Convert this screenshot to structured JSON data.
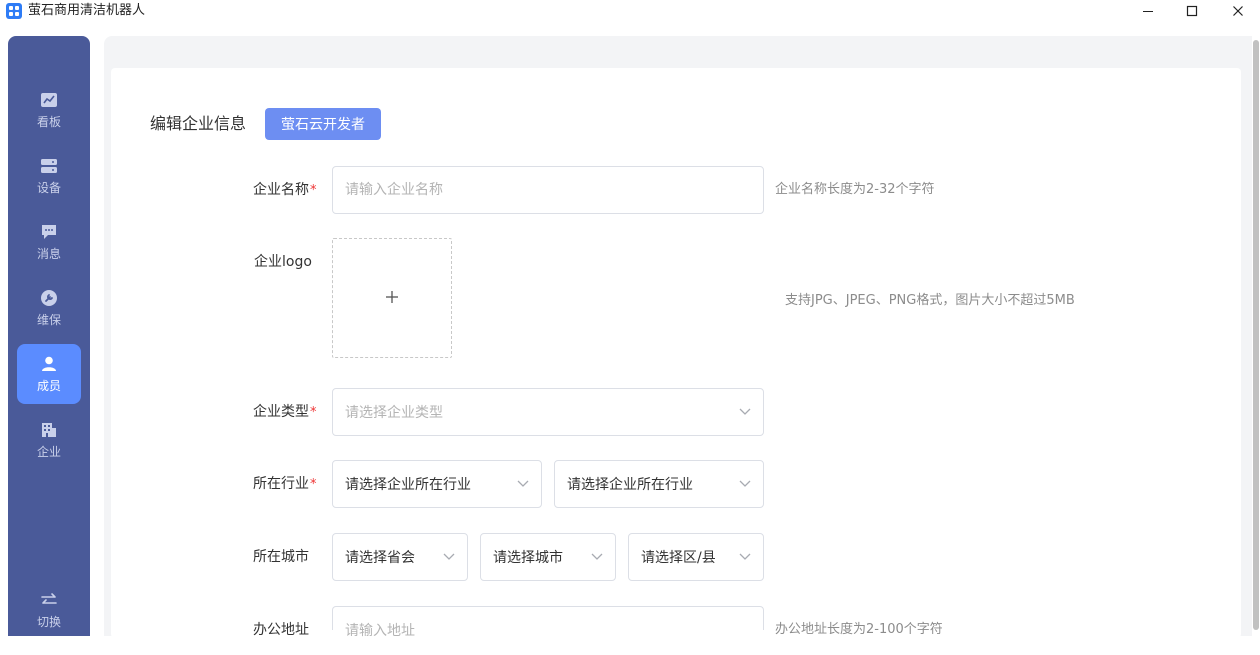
{
  "window": {
    "title": "萤石商用清洁机器人",
    "minimize_symbol": "—",
    "maximize_symbol": "☐",
    "close_symbol": "✕"
  },
  "sidebar": {
    "items": [
      {
        "label": "看板",
        "icon": "chart-icon"
      },
      {
        "label": "设备",
        "icon": "server-icon"
      },
      {
        "label": "消息",
        "icon": "message-icon"
      },
      {
        "label": "维保",
        "icon": "wrench-icon"
      },
      {
        "label": "成员",
        "icon": "user-icon",
        "active": true
      },
      {
        "label": "企业",
        "icon": "building-icon"
      }
    ],
    "switch": {
      "label": "切换",
      "icon": "swap-icon"
    }
  },
  "page": {
    "title": "编辑企业信息",
    "dev_button": "萤石云开发者"
  },
  "form": {
    "company_name": {
      "label": "企业名称",
      "required_mark": "*",
      "placeholder": "请输入企业名称",
      "hint": "企业名称长度为2-32个字符"
    },
    "logo": {
      "label": "企业logo",
      "upload_symbol": "+",
      "hint": "支持JPG、JPEG、PNG格式，图片大小不超过5MB"
    },
    "company_type": {
      "label": "企业类型",
      "required_mark": "*",
      "placeholder": "请选择企业类型"
    },
    "industry": {
      "label": "所在行业",
      "required_mark": "*",
      "select1": "请选择企业所在行业",
      "select2": "请选择企业所在行业"
    },
    "city": {
      "label": "所在城市",
      "province": "请选择省会",
      "city": "请选择城市",
      "district": "请选择区/县"
    },
    "address": {
      "label": "办公地址",
      "placeholder": "请输入地址",
      "hint": "办公地址长度为2-100个字符"
    }
  },
  "colors": {
    "sidebar_bg": "#4a5a99",
    "active_item": "#5b8cff",
    "primary_button": "#6d8ef2",
    "required": "#e33333"
  }
}
